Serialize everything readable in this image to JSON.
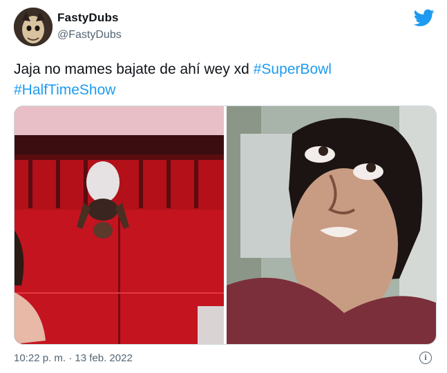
{
  "tweet": {
    "author_name": "FastyDubs",
    "author_handle": "@FastyDubs",
    "text_plain": "Jaja no mames bajate de ahí wey xd",
    "hashtag_1": "#SuperBowl",
    "hashtag_2": "#HalfTimeShow",
    "timestamp": "10:22 p. m. · 13 feb. 2022"
  },
  "icons": {
    "brand": "twitter-bird-icon",
    "info": "info-icon"
  },
  "colors": {
    "link": "#1d9bf0",
    "brand": "#1d9bf0",
    "secondary_text": "#536471"
  }
}
